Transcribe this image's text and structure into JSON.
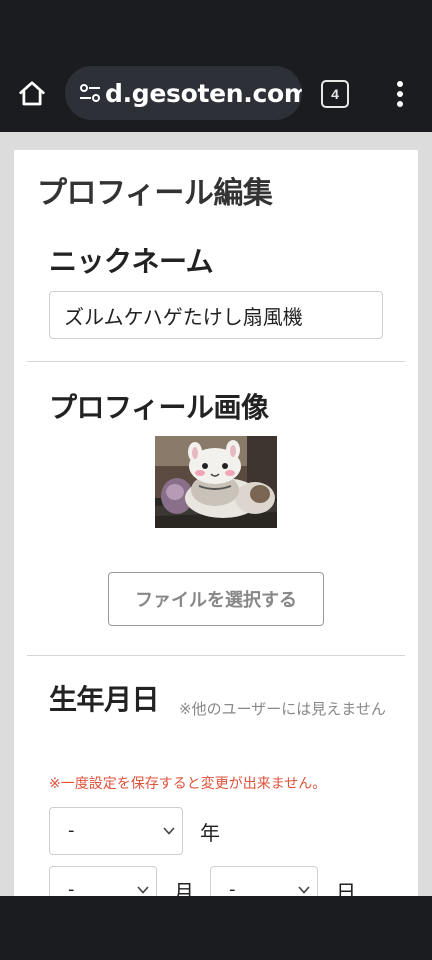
{
  "browser": {
    "url": "d.gesoten.com",
    "tab_count": "4"
  },
  "page": {
    "title": "プロフィール編集",
    "nickname": {
      "heading": "ニックネーム",
      "value": "ズルムケハゲたけし扇風機"
    },
    "profile_image": {
      "heading": "プロフィール画像",
      "choose_file_label": "ファイルを選択する"
    },
    "birthday": {
      "heading": "生年月日",
      "privacy_note": "※他のユーザーには見えません",
      "warning": "※一度設定を保存すると変更が出来ません。",
      "year_value": "-",
      "year_unit": "年",
      "month_value": "-",
      "month_unit": "月",
      "day_value": "-",
      "day_unit": "日"
    }
  },
  "icons": [
    "home-icon",
    "tune-icon",
    "tab-switcher-icon",
    "more-vert-icon",
    "chevron-down-icon"
  ]
}
